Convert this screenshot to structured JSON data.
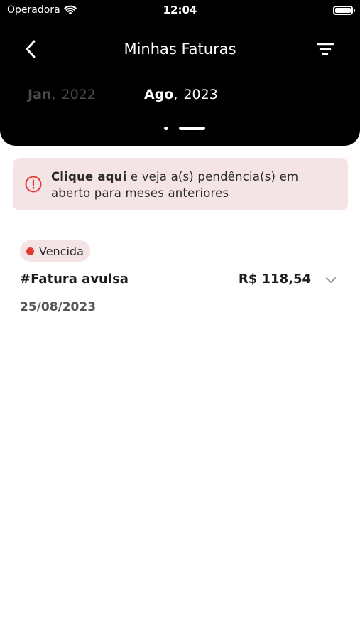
{
  "status_bar": {
    "carrier": "Operadora",
    "time": "12:04",
    "battery_level": 1.0
  },
  "nav": {
    "title": "Minhas Faturas",
    "back_icon": "chevron-left-icon",
    "filter_icon": "filter-icon"
  },
  "months": {
    "previous": {
      "month": "Jan",
      "separator": ",",
      "year": "2022"
    },
    "current": {
      "month": "Ago",
      "separator": ",",
      "year": "2023"
    }
  },
  "pager": {
    "pages": 2,
    "active_index": 1
  },
  "alert": {
    "bold_text": "Clique aqui",
    "text": " e veja a(s) pendência(s) em aberto para meses anteriores",
    "icon": "alert-circle-icon",
    "background": "#f5e4e6",
    "icon_color": "#e53935"
  },
  "invoices": [
    {
      "status": "Vencida",
      "status_color": "#e53935",
      "title": "#Fatura avulsa",
      "amount": "R$ 118,54",
      "date": "25/08/2023"
    }
  ]
}
